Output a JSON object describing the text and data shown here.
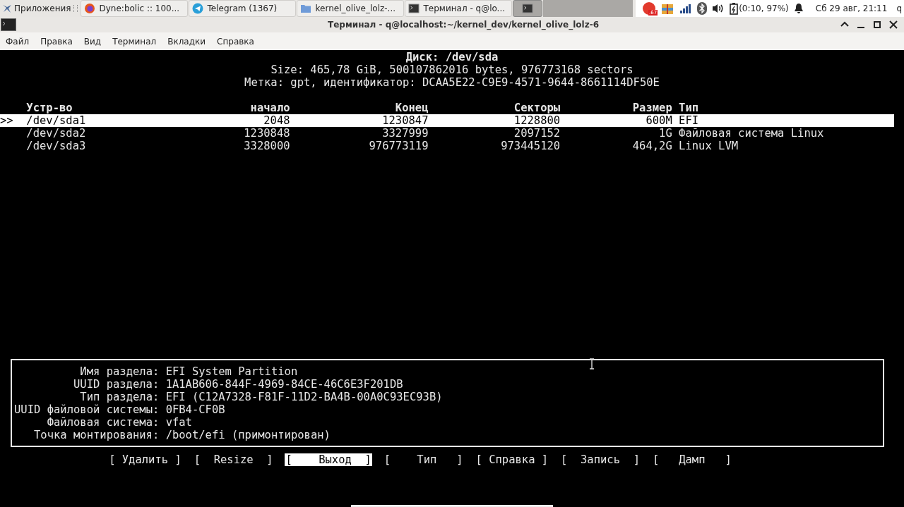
{
  "taskbar": {
    "apps_menu": "Приложения",
    "tasks": [
      {
        "kind": "browser",
        "label": "Dyne:bolic :: 100...",
        "selected": false
      },
      {
        "kind": "messenger",
        "label": "Telegram (1367)",
        "selected": false
      },
      {
        "kind": "folder",
        "label": "kernel_olive_lolz-...",
        "selected": false
      },
      {
        "kind": "terminal",
        "label": "Терминал - q@lo...",
        "selected": false
      },
      {
        "kind": "terminal",
        "selected": true
      }
    ],
    "tray_badge": ".67",
    "battery": "(0:10, 97%)",
    "clock": "Сб 29 авг, 21:11",
    "user": "q"
  },
  "window": {
    "title": "Терминал - q@localhost:~/kernel_dev/kernel_olive_lolz-6"
  },
  "menu": [
    "Файл",
    "Правка",
    "Вид",
    "Терминал",
    "Вкладки",
    "Справка"
  ],
  "disk": {
    "title": "Диск: /dev/sda",
    "size": "Size: 465,78 GiB, 500107862016 bytes, 976773168 sectors",
    "label": "Метка: gpt, идентификатор: DCAA5E22-C9E9-4571-9644-8661114DF50E"
  },
  "table": {
    "columns": [
      "Устр-во",
      "начало",
      "Конец",
      "Секторы",
      "Размер",
      "Тип"
    ],
    "rows": [
      {
        "marker": ">>",
        "cells": [
          "/dev/sda1",
          "2048",
          "1230847",
          "1228800",
          "600M",
          "EFI"
        ],
        "selected": true
      },
      {
        "cells": [
          "/dev/sda2",
          "1230848",
          "3327999",
          "2097152",
          "1G",
          "Файловая система Linux"
        ],
        "selected": false
      },
      {
        "cells": [
          "/dev/sda3",
          "3328000",
          "976773119",
          "973445120",
          "464,2G",
          "Linux LVM"
        ],
        "selected": false
      }
    ]
  },
  "details": [
    {
      "label": "Имя раздела:",
      "value": "EFI System Partition"
    },
    {
      "label": "UUID раздела:",
      "value": "1A1AB606-844F-4969-84CE-46C6E3F201DB"
    },
    {
      "label": "Тип раздела:",
      "value": "EFI (C12A7328-F81F-11D2-BA4B-00A0C93EC93B)"
    },
    {
      "label": "UUID файловой системы:",
      "value": "0FB4-CF0B"
    },
    {
      "label": "Файловая система:",
      "value": "vfat"
    },
    {
      "label": "Точка монтирования:",
      "value": "/boot/efi (примонтирован)"
    }
  ],
  "actions": [
    {
      "label": "[ Удалить ]",
      "selected": false
    },
    {
      "label": "[  Resize  ]",
      "selected": false
    },
    {
      "label": "[    Выход  ]",
      "selected": true
    },
    {
      "label": "[    Тип   ]",
      "selected": false
    },
    {
      "label": "[ Справка ]",
      "selected": false
    },
    {
      "label": "[  Запись  ]",
      "selected": false
    },
    {
      "label": "[   Дамп   ]",
      "selected": false
    }
  ]
}
